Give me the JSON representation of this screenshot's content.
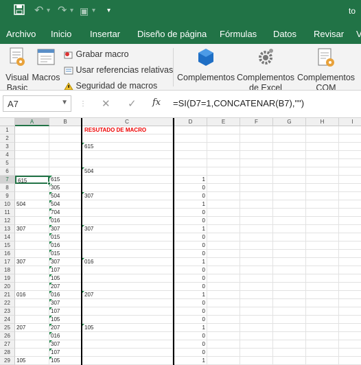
{
  "window": {
    "title_fragment": "to"
  },
  "quick_access": {
    "save": "save-icon",
    "undo": "undo-icon",
    "redo": "redo-icon",
    "touch": "touch-mode-icon",
    "more": "▾"
  },
  "menu": [
    "Archivo",
    "Inicio",
    "Insertar",
    "Diseño de página",
    "Fórmulas",
    "Datos",
    "Revisar",
    "V"
  ],
  "ribbon": {
    "visual_basic": "Visual Basic",
    "macros": "Macros",
    "record_macro": "Grabar macro",
    "relative_refs": "Usar referencias relativas",
    "macro_security": "Seguridad de macros",
    "addins": "Complementos",
    "excel_addins": "Complementos de Excel",
    "com_addins": "Complementos COM"
  },
  "formula_bar": {
    "name_box": "A7",
    "cancel": "✕",
    "enter": "✓",
    "fx": "fx",
    "formula": "=SI(D7=1,CONCATENAR(B7),\"\")"
  },
  "columns": [
    "A",
    "B",
    "C",
    "D",
    "E",
    "F",
    "G",
    "H",
    "I"
  ],
  "selected_column": "A",
  "selected_row": "7",
  "rows": [
    {
      "n": "1",
      "A": "",
      "B": "",
      "C": "RESUTADO DE MACRO",
      "D": ""
    },
    {
      "n": "2",
      "A": "",
      "B": "",
      "C": "",
      "D": ""
    },
    {
      "n": "3",
      "A": "",
      "B": "",
      "C": "615",
      "D": ""
    },
    {
      "n": "4",
      "A": "",
      "B": "",
      "C": "",
      "D": ""
    },
    {
      "n": "5",
      "A": "",
      "B": "",
      "C": "",
      "D": ""
    },
    {
      "n": "6",
      "A": "",
      "B": "",
      "C": "504",
      "D": ""
    },
    {
      "n": "7",
      "A": "615",
      "B": "615",
      "C": "",
      "D": "1"
    },
    {
      "n": "8",
      "A": "",
      "B": "305",
      "C": "",
      "D": "0"
    },
    {
      "n": "9",
      "A": "",
      "B": "504",
      "C": "307",
      "D": "0"
    },
    {
      "n": "10",
      "A": "504",
      "B": "504",
      "C": "",
      "D": "1"
    },
    {
      "n": "11",
      "A": "",
      "B": "704",
      "C": "",
      "D": "0"
    },
    {
      "n": "12",
      "A": "",
      "B": "016",
      "C": "",
      "D": "0"
    },
    {
      "n": "13",
      "A": "307",
      "B": "307",
      "C": "307",
      "D": "1"
    },
    {
      "n": "14",
      "A": "",
      "B": "015",
      "C": "",
      "D": "0"
    },
    {
      "n": "15",
      "A": "",
      "B": "016",
      "C": "",
      "D": "0"
    },
    {
      "n": "16",
      "A": "",
      "B": "015",
      "C": "",
      "D": "0"
    },
    {
      "n": "17",
      "A": "307",
      "B": "307",
      "C": "016",
      "D": "1"
    },
    {
      "n": "18",
      "A": "",
      "B": "107",
      "C": "",
      "D": "0"
    },
    {
      "n": "19",
      "A": "",
      "B": "105",
      "C": "",
      "D": "0"
    },
    {
      "n": "20",
      "A": "",
      "B": "207",
      "C": "",
      "D": "0"
    },
    {
      "n": "21",
      "A": "016",
      "B": "016",
      "C": "207",
      "D": "1"
    },
    {
      "n": "22",
      "A": "",
      "B": "307",
      "C": "",
      "D": "0"
    },
    {
      "n": "23",
      "A": "",
      "B": "107",
      "C": "",
      "D": "0"
    },
    {
      "n": "24",
      "A": "",
      "B": "105",
      "C": "",
      "D": "0"
    },
    {
      "n": "25",
      "A": "207",
      "B": "207",
      "C": "105",
      "D": "1"
    },
    {
      "n": "26",
      "A": "",
      "B": "016",
      "C": "",
      "D": "0"
    },
    {
      "n": "27",
      "A": "",
      "B": "307",
      "C": "",
      "D": "0"
    },
    {
      "n": "28",
      "A": "",
      "B": "107",
      "C": "",
      "D": "0"
    },
    {
      "n": "29",
      "A": "105",
      "B": "105",
      "C": "",
      "D": "1"
    }
  ],
  "colors": {
    "accent": "#217346",
    "title_red": "#e00000"
  }
}
